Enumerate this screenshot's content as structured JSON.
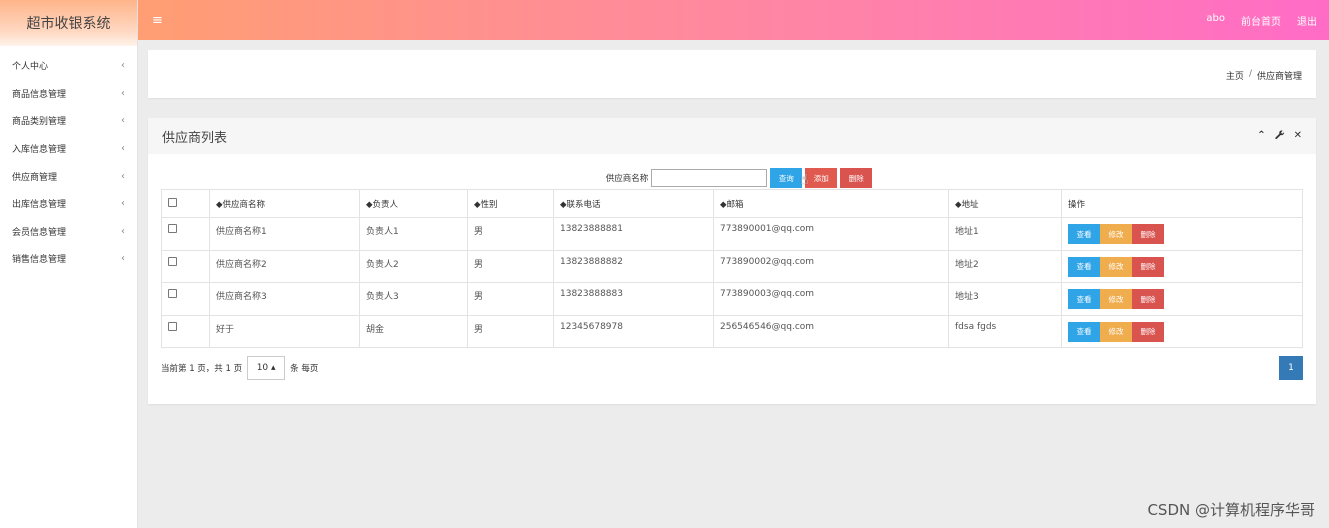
{
  "app": {
    "title": "超市收银系统"
  },
  "sidebar": {
    "items": [
      {
        "label": "个人中心"
      },
      {
        "label": "商品信息管理"
      },
      {
        "label": "商品类别管理"
      },
      {
        "label": "入库信息管理"
      },
      {
        "label": "供应商管理"
      },
      {
        "label": "出库信息管理"
      },
      {
        "label": "会员信息管理"
      },
      {
        "label": "销售信息管理"
      }
    ],
    "chevron": "‹"
  },
  "topbar": {
    "menu_icon": "≡",
    "user": "abo",
    "front_page": "前台首页",
    "logout": "退出"
  },
  "breadcrumb": {
    "home": "主页",
    "sep": "/",
    "current": "供应商管理"
  },
  "panel": {
    "title": "供应商列表",
    "tool_collapse": "⌃",
    "tool_settings": "🔧",
    "tool_close": "✕"
  },
  "search": {
    "label": "供应商名称",
    "value": "",
    "query_button": "查询",
    "add_button": "添加",
    "delete_button": "删除"
  },
  "table": {
    "headers": [
      "◆供应商名称",
      "◆负责人",
      "◆性别",
      "◆联系电话",
      "◆邮箱",
      "◆地址",
      "操作"
    ],
    "rows": [
      [
        "供应商名称1",
        "负责人1",
        "男",
        "13823888881",
        "773890001@qq.com",
        "地址1"
      ],
      [
        "供应商名称2",
        "负责人2",
        "男",
        "13823888882",
        "773890002@qq.com",
        "地址2"
      ],
      [
        "供应商名称3",
        "负责人3",
        "男",
        "13823888883",
        "773890003@qq.com",
        "地址3"
      ],
      [
        "好于",
        "胡金",
        "男",
        "12345678978",
        "256546546@qq.com",
        "fdsa fgds"
      ]
    ],
    "row_actions": {
      "view": "查看",
      "edit": "修改",
      "delete": "删除"
    }
  },
  "pager": {
    "info": "当前第 1 页，共 1 页",
    "page_size": "10 ▴",
    "per_page_suffix": "条 每页",
    "current_page": "1"
  },
  "watermark": "CSDN @计算机程序华哥",
  "colors": {
    "topbar_start": "#ff9e73",
    "topbar_end": "#ff6cc6",
    "btn_info": "#2fa4e7",
    "btn_warning": "#f0ad4e",
    "btn_danger": "#d9534f",
    "page_active": "#337ab7"
  }
}
